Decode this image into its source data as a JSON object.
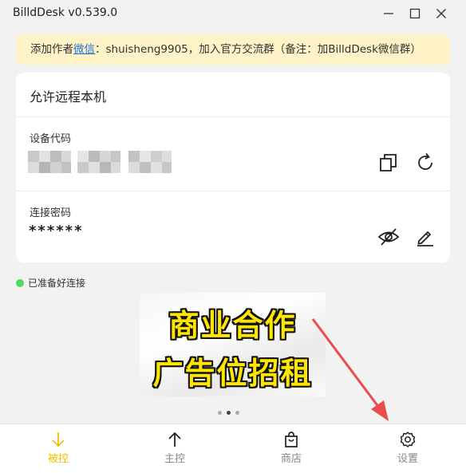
{
  "window": {
    "title": "BilldDesk v0.539.0"
  },
  "notice": {
    "prefix": "添加作者",
    "link": "微信",
    "suffix": "：shuisheng9905，加入官方交流群（备注：加BilldDesk微信群）"
  },
  "remote": {
    "title": "允许远程本机",
    "device_code_label": "设备代码",
    "password_label": "连接密码",
    "password_value": "******"
  },
  "status": {
    "text": "已准备好连接",
    "color": "#4cd964"
  },
  "banner": {
    "line1": "商业合作",
    "line2": "广告位招租",
    "dots": 3,
    "active_dot": 1
  },
  "tabs": [
    {
      "label": "被控",
      "icon": "arrow-down-icon",
      "active": true
    },
    {
      "label": "主控",
      "icon": "arrow-up-icon",
      "active": false
    },
    {
      "label": "商店",
      "icon": "shopping-bag-icon",
      "active": false
    },
    {
      "label": "设置",
      "icon": "gear-icon",
      "active": false
    }
  ],
  "colors": {
    "accent": "#f0c000",
    "notice_bg": "#fdf3c7",
    "link": "#1d6fd8",
    "annotation_arrow": "#e84c4c"
  }
}
